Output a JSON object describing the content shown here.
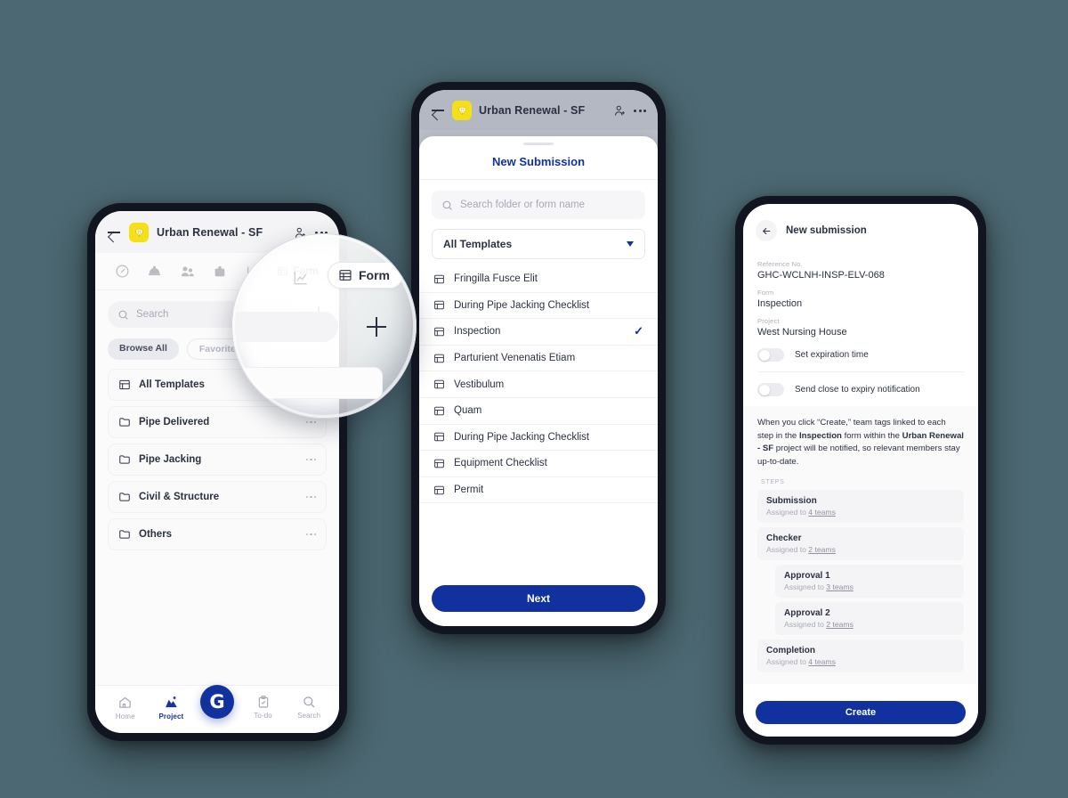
{
  "background_color": "#4c6872",
  "accent_blue": "#11319e",
  "brand_yellow": "#f5e018",
  "phone1": {
    "header": {
      "title": "Urban Renewal - SF",
      "back_icon": "back-arrow-icon",
      "badge_icon": "gem-icon",
      "person_icon": "add-person-icon",
      "more_icon": "more-dots-icon"
    },
    "tabs": [
      "gauge-icon",
      "helmet-icon",
      "people-icon",
      "box-icon",
      "chart-icon"
    ],
    "form_chip": {
      "label": "Form",
      "icon": "table-icon"
    },
    "search": {
      "placeholder": "Search",
      "icon": "search-icon"
    },
    "add_button": "add-icon",
    "chips": [
      {
        "label": "Browse All",
        "active": true
      },
      {
        "label": "Favorite",
        "active": false
      }
    ],
    "list": [
      {
        "label": "All Templates",
        "icon": "template-icon",
        "menu": false
      },
      {
        "label": "Pipe Delivered",
        "icon": "folder-icon",
        "menu": true
      },
      {
        "label": "Pipe Jacking",
        "icon": "folder-icon",
        "menu": true
      },
      {
        "label": "Civil & Structure",
        "icon": "folder-icon",
        "menu": true
      },
      {
        "label": "Others",
        "icon": "folder-icon",
        "menu": true
      }
    ],
    "bottom_nav": [
      {
        "label": "Home",
        "icon": "home-icon",
        "active": false
      },
      {
        "label": "Project",
        "icon": "project-icon",
        "active": true
      },
      {
        "label": "G",
        "icon": "g-logo-icon",
        "active": false
      },
      {
        "label": "To-do",
        "icon": "clipboard-icon",
        "active": false
      },
      {
        "label": "Search",
        "icon": "search-icon",
        "active": false
      }
    ]
  },
  "magnifier": {
    "form_chip_label": "Form",
    "form_chip_icon": "table-icon",
    "plus_icon": "add-icon"
  },
  "phone2": {
    "header": {
      "title": "Urban Renewal - SF",
      "back_icon": "back-arrow-icon",
      "badge_icon": "gem-icon",
      "person_icon": "add-person-icon",
      "more_icon": "more-dots-icon"
    },
    "sheet_title": "New Submission",
    "search": {
      "placeholder": "Search folder or form name",
      "icon": "search-icon"
    },
    "select": {
      "value": "All Templates",
      "caret_icon": "chevron-down-icon"
    },
    "items": [
      {
        "label": "Fringilla Fusce Elit",
        "selected": false
      },
      {
        "label": "During Pipe Jacking Checklist",
        "selected": false
      },
      {
        "label": "Inspection",
        "selected": true
      },
      {
        "label": "Parturient Venenatis Etiam",
        "selected": false
      },
      {
        "label": "Vestibulum",
        "selected": false
      },
      {
        "label": "Quam",
        "selected": false
      },
      {
        "label": "During Pipe Jacking Checklist",
        "selected": false
      },
      {
        "label": "Equipment Checklist",
        "selected": false
      },
      {
        "label": "Permit",
        "selected": false
      }
    ],
    "check_glyph": "✓",
    "next_button": "Next"
  },
  "phone3": {
    "title": "New submission",
    "back_icon": "back-arrow-icon",
    "fields": [
      {
        "key": "Reference No.",
        "value": "GHC-WCLNH-INSP-ELV-068"
      },
      {
        "key": "Form",
        "value": "Inspection"
      },
      {
        "key": "Project",
        "value": "West Nursing House"
      }
    ],
    "toggles": [
      {
        "label": "Set expiration time",
        "on": false
      },
      {
        "label": "Send close to expiry notification",
        "on": false
      }
    ],
    "notice": {
      "part1": "When you click “Create,” team tags linked to each step in the ",
      "bold1": "Inspection",
      "part2": " form within the ",
      "bold2": "Urban Renewal - SF",
      "part3": " project will be notified, so relevant members stay up-to-date."
    },
    "steps_label": "STEPS",
    "steps": [
      {
        "name": "Submission",
        "assigned_prefix": "Assigned to ",
        "assigned_link": "4 teams",
        "indented": false
      },
      {
        "name": "Checker",
        "assigned_prefix": "Assigned to ",
        "assigned_link": "2 teams",
        "indented": false
      },
      {
        "name": "Approval 1",
        "assigned_prefix": "Assigned to ",
        "assigned_link": "3 teams",
        "indented": true
      },
      {
        "name": "Approval 2",
        "assigned_prefix": "Assigned to ",
        "assigned_link": "2 teams",
        "indented": true
      },
      {
        "name": "Completion",
        "assigned_prefix": "Assigned to ",
        "assigned_link": "4 teams",
        "indented": false
      }
    ],
    "create_button": "Create"
  }
}
